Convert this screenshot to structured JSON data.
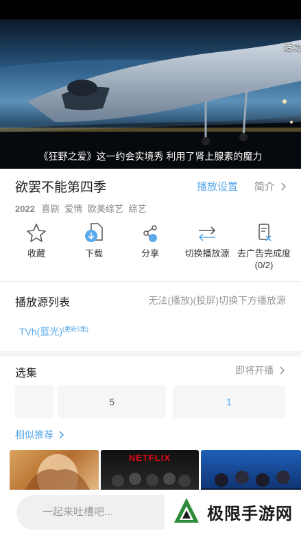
{
  "video": {
    "subtitle": "《狂野之爱》这一约会实境秀 利用了肾上腺素的魔力",
    "corner_text": "话功"
  },
  "show": {
    "title": "欲罢不能第四季",
    "play_settings": "播放设置",
    "intro": "简介",
    "year": "2022",
    "tags": [
      "喜剧",
      "爱情",
      "欧美综艺",
      "综艺"
    ]
  },
  "actions": [
    {
      "label": "收藏",
      "icon": "star-icon"
    },
    {
      "label": "下载",
      "icon": "download-icon"
    },
    {
      "label": "分享",
      "icon": "share-icon"
    },
    {
      "label": "切换播放源",
      "icon": "switch-source-icon"
    },
    {
      "label": "去广告完成度",
      "sub": "(0/2)",
      "icon": "ad-block-icon"
    }
  ],
  "sources": {
    "title": "播放源列表",
    "hint": "无法(播放)(投屏)切换下方播放源",
    "source_name": "TVh(蓝光)",
    "source_badge": "(更新5集)"
  },
  "episodes": {
    "title": "选集",
    "status": "即将开播",
    "items": [
      "",
      "5",
      "1"
    ]
  },
  "similar": {
    "label": "相似推荐",
    "netflix_text": "NETFLIX"
  },
  "comment": {
    "placeholder": "一起来吐槽吧..."
  },
  "watermark": {
    "text": "极限手游网"
  },
  "colors": {
    "accent": "#5aa9ea",
    "muted": "#888888"
  }
}
